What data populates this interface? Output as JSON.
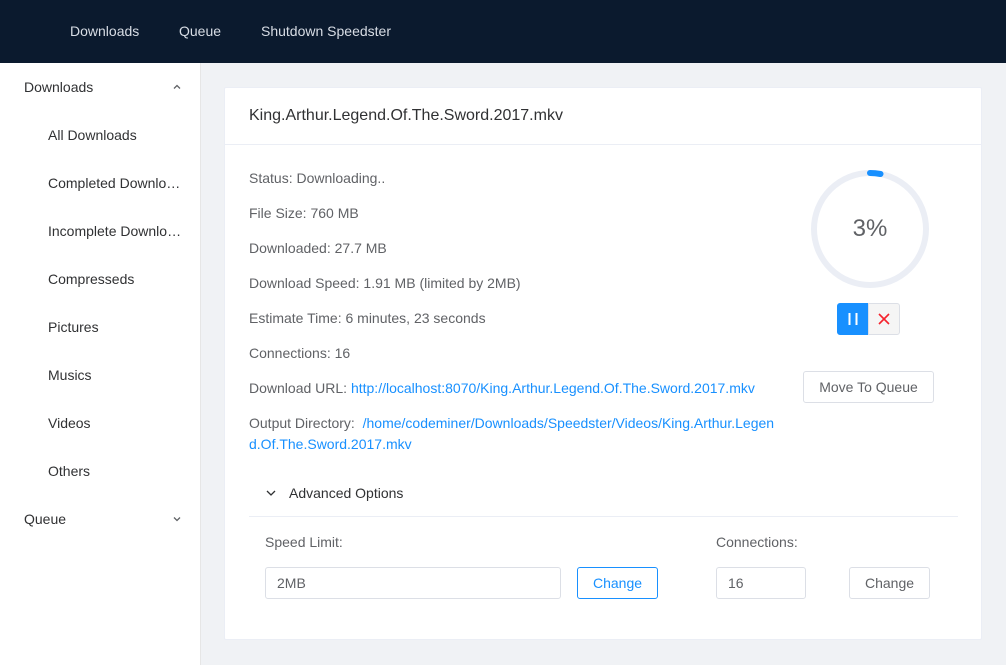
{
  "topnav": {
    "items": [
      "Downloads",
      "Queue",
      "Shutdown Speedster"
    ]
  },
  "sidebar": {
    "downloads_group": "Downloads",
    "items": [
      "All Downloads",
      "Completed Downloads",
      "Incomplete Downloads",
      "Compresseds",
      "Pictures",
      "Musics",
      "Videos",
      "Others"
    ],
    "queue_group": "Queue"
  },
  "download": {
    "filename": "King.Arthur.Legend.Of.The.Sword.2017.mkv",
    "status_label": "Status:",
    "status": "Downloading..",
    "file_size_label": "File Size:",
    "file_size": "760 MB",
    "downloaded_label": "Downloaded:",
    "downloaded": "27.7 MB",
    "speed_label": "Download Speed:",
    "speed": "1.91 MB (limited by 2MB)",
    "estimate_label": "Estimate Time:",
    "estimate": "6 minutes, 23 seconds",
    "connections_label": "Connections:",
    "connections": "16",
    "url_label": "Download URL:",
    "url": "http://localhost:8070/King.Arthur.Legend.Of.The.Sword.2017.mkv",
    "output_label": "Output Directory:",
    "output_dir": "/home/codeminer/Downloads/Speedster/Videos/King.Arthur.Legend.Of.The.Sword.2017.mkv",
    "progress_text": "3%",
    "progress_percent": 3
  },
  "actions": {
    "pause_icon": "pause-icon",
    "cancel_icon": "close-icon",
    "move_to_queue": "Move To Queue"
  },
  "advanced": {
    "title": "Advanced Options",
    "speed_limit_label": "Speed Limit:",
    "speed_limit_value": "2MB",
    "speed_change": "Change",
    "connections_label": "Connections:",
    "connections_value": "16",
    "connections_change": "Change"
  },
  "colors": {
    "accent": "#1890ff",
    "topbar": "#0b1a2e",
    "danger": "#f5222d"
  }
}
